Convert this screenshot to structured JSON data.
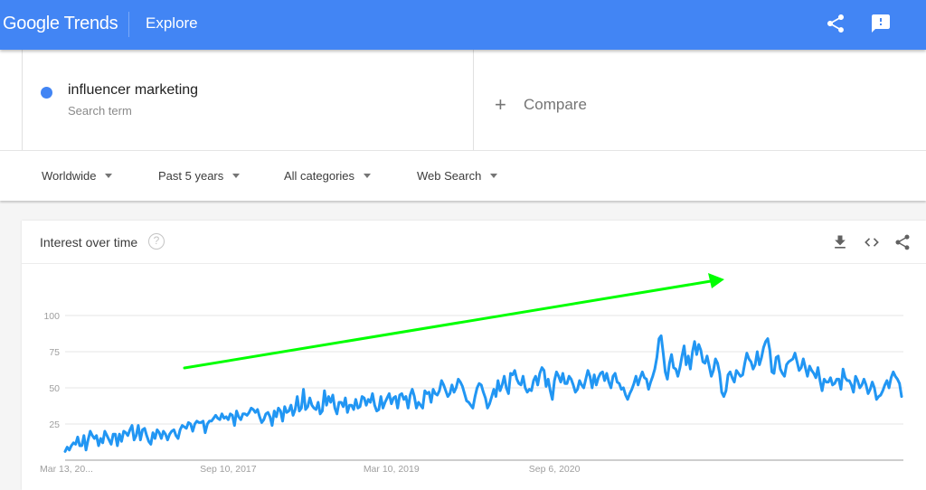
{
  "app": {
    "brand": "Google Trends",
    "section": "Explore",
    "brand_color": "#4285f4",
    "icons": {
      "share": "share-icon",
      "feedback": "feedback-icon"
    }
  },
  "search": {
    "term": "influencer marketing",
    "term_type": "Search term",
    "term_color": "#4285f4",
    "compare_label": "Compare"
  },
  "filters": [
    {
      "label": "Worldwide"
    },
    {
      "label": "Past 5 years"
    },
    {
      "label": "All categories"
    },
    {
      "label": "Web Search"
    }
  ],
  "card": {
    "title": "Interest over time",
    "help": "?",
    "actions": [
      "download-icon",
      "embed-icon",
      "share-icon"
    ]
  },
  "annotation": {
    "type": "arrow",
    "color": "#00ff00",
    "meaning": "upward trend"
  },
  "chart_data": {
    "type": "line",
    "title": "Interest over time",
    "xlabel": "",
    "ylabel": "",
    "ylim": [
      0,
      100
    ],
    "yticks": [
      25,
      50,
      75,
      100
    ],
    "xtick_labels": [
      "Mar 13, 20...",
      "Sep 10, 2017",
      "Mar 10, 2019",
      "Sep 6, 2020"
    ],
    "xtick_index": [
      0,
      78,
      156,
      234
    ],
    "grid": true,
    "legend": "none",
    "series": [
      {
        "name": "influencer marketing",
        "color": "#2196f3",
        "values": [
          6,
          9,
          7,
          10,
          12,
          11,
          16,
          10,
          10,
          17,
          7,
          14,
          20,
          17,
          15,
          17,
          10,
          15,
          12,
          20,
          17,
          14,
          11,
          18,
          18,
          10,
          18,
          13,
          20,
          19,
          17,
          21,
          24,
          14,
          17,
          24,
          14,
          21,
          22,
          17,
          13,
          11,
          19,
          15,
          21,
          19,
          15,
          20,
          18,
          14,
          18,
          20,
          21,
          17,
          15,
          21,
          24,
          23,
          22,
          26,
          25,
          20,
          25,
          27,
          26,
          26,
          27,
          19,
          25,
          27,
          27,
          29,
          31,
          29,
          28,
          32,
          29,
          30,
          28,
          32,
          31,
          24,
          34,
          30,
          28,
          32,
          32,
          31,
          33,
          36,
          35,
          33,
          35,
          30,
          26,
          28,
          32,
          33,
          30,
          24,
          34,
          30,
          36,
          34,
          27,
          37,
          33,
          34,
          38,
          31,
          35,
          44,
          34,
          36,
          49,
          35,
          37,
          43,
          38,
          36,
          35,
          40,
          32,
          34,
          48,
          38,
          44,
          40,
          45,
          36,
          32,
          40,
          40,
          37,
          43,
          33,
          38,
          38,
          35,
          42,
          36,
          37,
          44,
          43,
          38,
          42,
          40,
          46,
          38,
          34,
          35,
          44,
          36,
          40,
          43,
          46,
          39,
          43,
          44,
          36,
          45,
          46,
          42,
          44,
          36,
          45,
          49,
          44,
          36,
          40,
          38,
          36,
          48,
          46,
          47,
          40,
          49,
          46,
          45,
          48,
          55,
          52,
          48,
          44,
          46,
          52,
          47,
          50,
          56,
          54,
          51,
          46,
          41,
          40,
          38,
          36,
          44,
          50,
          53,
          52,
          47,
          43,
          36,
          39,
          44,
          49,
          44,
          55,
          48,
          52,
          58,
          50,
          46,
          60,
          59,
          62,
          56,
          53,
          52,
          58,
          50,
          47,
          49,
          48,
          55,
          58,
          52,
          60,
          64,
          62,
          51,
          56,
          48,
          42,
          55,
          61,
          58,
          54,
          60,
          53,
          53,
          58,
          56,
          52,
          47,
          49,
          55,
          52,
          50,
          56,
          62,
          58,
          50,
          59,
          52,
          57,
          60,
          61,
          55,
          60,
          54,
          50,
          58,
          60,
          54,
          53,
          49,
          50,
          45,
          42,
          46,
          49,
          53,
          58,
          52,
          57,
          61,
          57,
          56,
          49,
          54,
          58,
          63,
          71,
          84,
          86,
          74,
          61,
          56,
          67,
          73,
          64,
          63,
          58,
          64,
          72,
          79,
          66,
          72,
          63,
          75,
          82,
          73,
          80,
          76,
          68,
          67,
          72,
          65,
          58,
          62,
          70,
          67,
          60,
          47,
          44,
          48,
          59,
          61,
          57,
          54,
          62,
          60,
          58,
          59,
          67,
          74,
          70,
          68,
          63,
          66,
          75,
          66,
          71,
          78,
          82,
          84,
          76,
          61,
          60,
          71,
          72,
          63,
          60,
          58,
          66,
          68,
          69,
          70,
          74,
          68,
          62,
          64,
          70,
          64,
          58,
          65,
          62,
          60,
          57,
          64,
          55,
          48,
          56,
          54,
          54,
          57,
          52,
          53,
          56,
          56,
          49,
          63,
          57,
          55,
          55,
          52,
          47,
          58,
          55,
          50,
          52,
          56,
          52,
          46,
          49,
          54,
          50,
          42,
          44,
          45,
          48,
          52,
          55,
          50,
          57,
          61,
          58,
          56,
          53,
          44
        ]
      }
    ]
  }
}
